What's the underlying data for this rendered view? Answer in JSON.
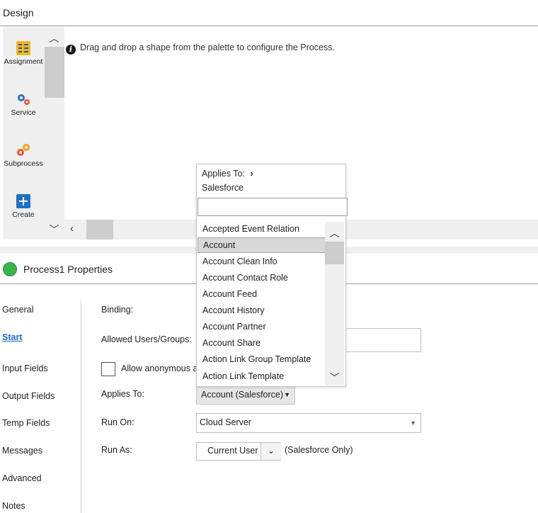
{
  "header": {
    "title": "Design"
  },
  "palette": {
    "items": [
      {
        "label": "Assignment",
        "icon": "assignment-icon"
      },
      {
        "label": "Service",
        "icon": "service-gear-icon"
      },
      {
        "label": "Subprocess",
        "icon": "subprocess-icon"
      },
      {
        "label": "Create",
        "icon": "plus-icon"
      }
    ]
  },
  "canvas": {
    "hint": "Drag and drop a shape from the palette to configure the Process."
  },
  "properties": {
    "title": "Process1 Properties",
    "status_color": "#3ab54a",
    "nav": [
      "General",
      "Start",
      "Input Fields",
      "Output Fields",
      "Temp Fields",
      "Messages",
      "Advanced",
      "Notes"
    ],
    "active_nav": "Start",
    "fields": {
      "binding_label": "Binding:",
      "allowed_label": "Allowed Users/Groups:",
      "allow_anon_label": "Allow anonymous a",
      "applies_label": "Applies To:",
      "applies_value": "Account (Salesforce)",
      "run_on_label": "Run On:",
      "run_on_value": "Cloud Server",
      "run_as_label": "Run As:",
      "run_as_value": "Current User",
      "run_as_note": "(Salesforce Only)"
    }
  },
  "dropdown": {
    "breadcrumb": "Applies To:",
    "chevron": "›",
    "source": "Salesforce",
    "search_value": "",
    "selected": "Account",
    "items": [
      "Accepted Event Relation",
      "Account",
      "Account Clean Info",
      "Account Contact Role",
      "Account Feed",
      "Account History",
      "Account Partner",
      "Account Share",
      "Action Link Group Template",
      "Action Link Template"
    ]
  },
  "accent": "#1f6fc9"
}
